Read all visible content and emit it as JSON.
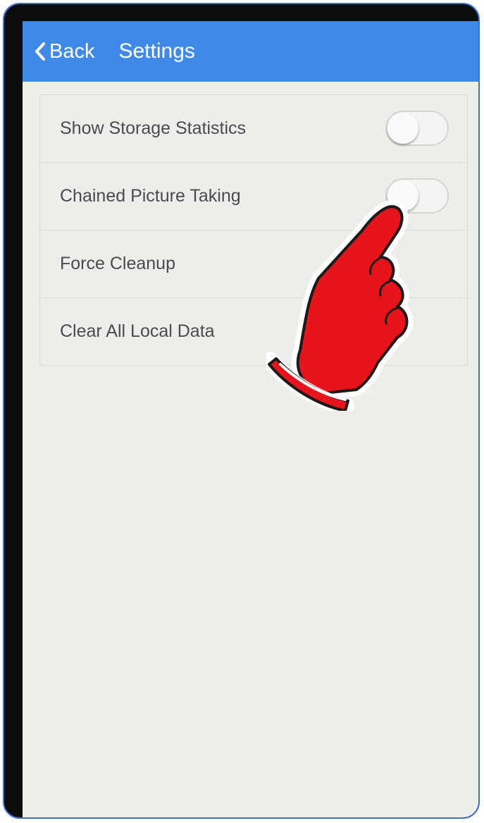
{
  "header": {
    "back_label": "Back",
    "title": "Settings",
    "color": "#3f8ae8"
  },
  "settings": {
    "items": [
      {
        "label": "Show Storage Statistics",
        "type": "toggle",
        "on": false
      },
      {
        "label": "Chained Picture Taking",
        "type": "toggle",
        "on": false
      },
      {
        "label": "Force Cleanup",
        "type": "action"
      },
      {
        "label": "Clear All Local Data",
        "type": "action"
      }
    ]
  },
  "overlay": {
    "icon": "pointing-hand-icon",
    "color": "#e8141b"
  }
}
